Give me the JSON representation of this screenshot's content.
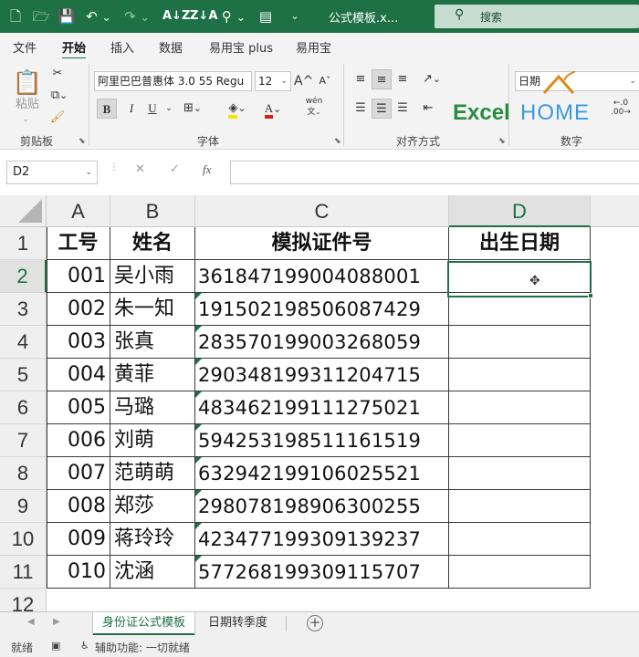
{
  "quick_access": {
    "new_icon": "new-file-icon",
    "open_icon": "open-folder-icon",
    "save_icon": "save-icon",
    "undo_icon": "undo-icon",
    "redo_icon": "redo-icon",
    "sort_asc_icon": "sort-ascending-icon",
    "sort_desc_icon": "sort-descending-icon",
    "find_icon": "find-icon",
    "preview_icon": "print-preview-icon",
    "more_icon": "chevron-down-icon"
  },
  "title": "公式模板.x...",
  "search": {
    "label": "搜索"
  },
  "menu": {
    "tabs": [
      {
        "label": "文件"
      },
      {
        "label": "开始"
      },
      {
        "label": "插入"
      },
      {
        "label": "数据"
      },
      {
        "label": "易用宝 plus"
      },
      {
        "label": "易用宝"
      }
    ],
    "active_index": 1
  },
  "ribbon": {
    "clipboard": {
      "label": "剪贴板",
      "paste": "粘贴"
    },
    "font": {
      "label": "字体",
      "family": "阿里巴巴普惠体 3.0 55 Regu",
      "size": "12",
      "bold": "B",
      "italic": "I",
      "underline": "U",
      "grow": "A",
      "shrink": "A",
      "phonetic": "wén"
    },
    "alignment": {
      "label": "对齐方式"
    },
    "number": {
      "label": "数字",
      "format": "日期"
    },
    "logo": {
      "part1": "Excel",
      "part2": "HOME"
    }
  },
  "formula_bar": {
    "name_box": "D2",
    "fx": "fx",
    "value": ""
  },
  "grid": {
    "columns": [
      "A",
      "B",
      "C",
      "D"
    ],
    "rows": [
      "1",
      "2",
      "3",
      "4",
      "5",
      "6",
      "7",
      "8",
      "9",
      "10",
      "11",
      "12"
    ],
    "active_cell": "D2",
    "headers": [
      "工号",
      "姓名",
      "模拟证件号",
      "出生日期"
    ],
    "records": [
      {
        "id": "001",
        "name": "吴小雨",
        "cert": "361847199004088001",
        "birth": ""
      },
      {
        "id": "002",
        "name": "朱一知",
        "cert": "191502198506087429",
        "birth": ""
      },
      {
        "id": "003",
        "name": "张真",
        "cert": "283570199003268059",
        "birth": ""
      },
      {
        "id": "004",
        "name": "黄菲",
        "cert": "290348199311204715",
        "birth": ""
      },
      {
        "id": "005",
        "name": "马璐",
        "cert": "483462199111275021",
        "birth": ""
      },
      {
        "id": "006",
        "name": "刘萌",
        "cert": "594253198511161519",
        "birth": ""
      },
      {
        "id": "007",
        "name": "范萌萌",
        "cert": "632942199106025521",
        "birth": ""
      },
      {
        "id": "008",
        "name": "郑莎",
        "cert": "298078198906300255",
        "birth": ""
      },
      {
        "id": "009",
        "name": "蒋玲玲",
        "cert": "423477199309139237",
        "birth": ""
      },
      {
        "id": "010",
        "name": "沈涵",
        "cert": "577268199309115707",
        "birth": ""
      }
    ]
  },
  "sheets": {
    "tabs": [
      {
        "label": "身份证公式模板"
      },
      {
        "label": "日期转季度"
      }
    ],
    "active_index": 0,
    "add_label": "+"
  },
  "status": {
    "ready": "就绪",
    "accessibility": "辅助功能: 一切就绪"
  },
  "colors": {
    "accent": "#1e7145",
    "title_bar": "#1e7145",
    "search_box": "#c6dccf"
  }
}
